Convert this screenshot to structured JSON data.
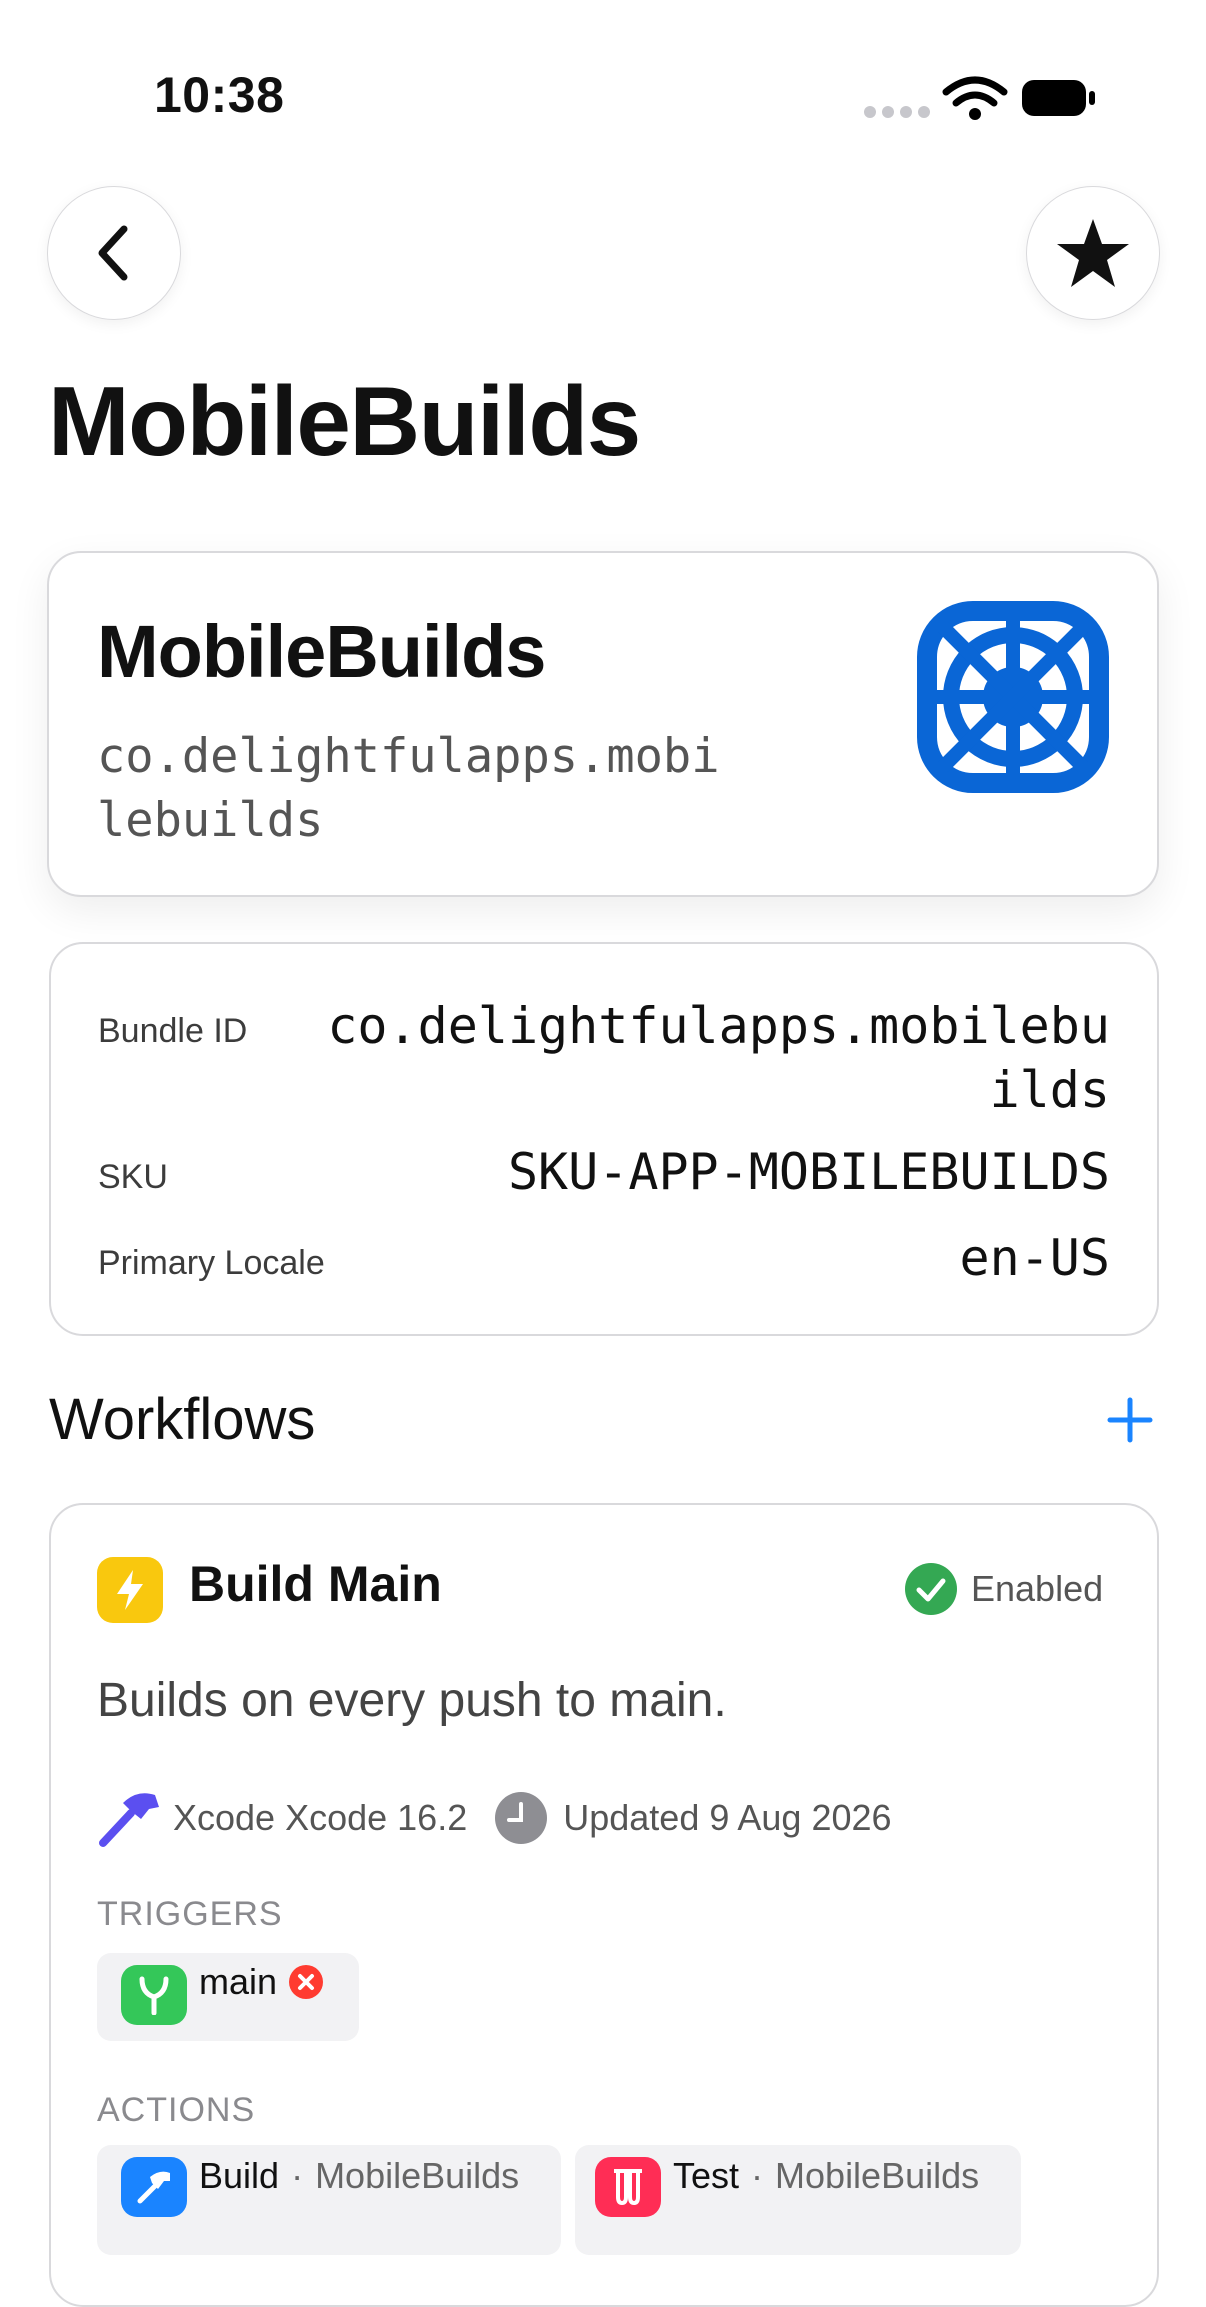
{
  "status_bar": {
    "time": "10:38"
  },
  "nav": {
    "back": "back",
    "favorite": "favorite"
  },
  "page": {
    "title": "MobileBuilds"
  },
  "app": {
    "name": "MobileBuilds",
    "bundle_display": "co.delightfulapps.mobilebuilds",
    "icon_color": "#0a66d6"
  },
  "info": {
    "rows": [
      {
        "label": "Bundle ID",
        "value": "co.delightfulapps.mobilebuilds"
      },
      {
        "label": "SKU",
        "value": "SKU-APP-MOBILEBUILDS"
      },
      {
        "label": "Primary Locale",
        "value": "en-US"
      }
    ]
  },
  "workflows": {
    "title": "Workflows",
    "accent": "#1a84ff",
    "items": [
      {
        "name": "Build Main",
        "status": "Enabled",
        "description": "Builds on every push to main.",
        "xcode": "Xcode Xcode 16.2",
        "updated": "Updated 9 Aug 2026",
        "triggers_label": "TRIGGERS",
        "trigger": "main",
        "actions_label": "ACTIONS",
        "actions": [
          {
            "name": "Build",
            "target": "MobileBuilds"
          },
          {
            "name": "Test",
            "target": "MobileBuilds"
          }
        ]
      }
    ]
  }
}
